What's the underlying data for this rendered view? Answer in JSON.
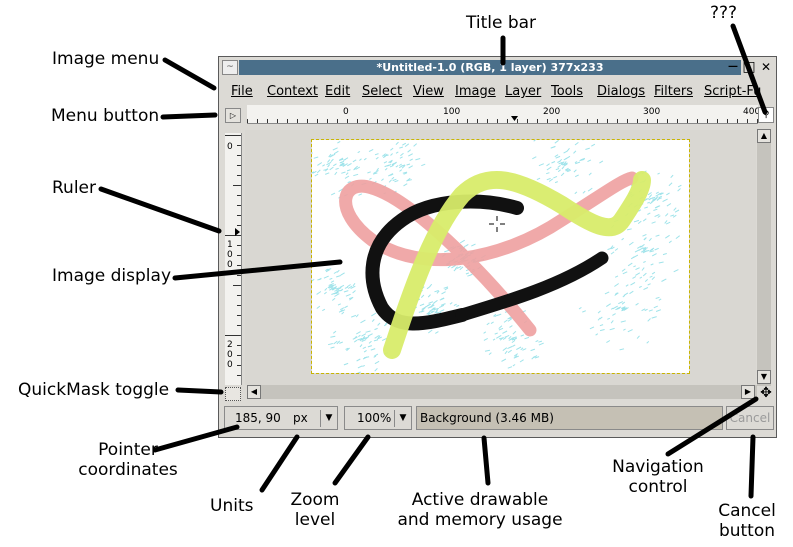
{
  "window": {
    "title": "*Untitled-1.0 (RGB, 1 layer) 377x233",
    "minimize_glyph": "—",
    "maximize_glyph": "□",
    "close_glyph": "✕"
  },
  "menus": [
    "File",
    "Context",
    "Edit",
    "Select",
    "View",
    "Image",
    "Layer",
    "Tools",
    "Dialogs",
    "Filters",
    "Script-Fu"
  ],
  "ruler": {
    "horizontal_ticks": [
      "0",
      "100",
      "200",
      "300",
      "400"
    ],
    "vertical_ticks": [
      "0",
      "1\n0\n0",
      "2\n0\n0"
    ]
  },
  "status": {
    "coordinates": "185, 90",
    "units": "px",
    "zoom": "100%",
    "drawable": "Background (3.46 MB)",
    "cancel": "Cancel"
  },
  "labels": {
    "title_bar": "Title bar",
    "unknown": "???",
    "image_menu": "Image menu",
    "menu_button": "Menu button",
    "ruler": "Ruler",
    "image_display": "Image display",
    "quickmask_toggle": "QuickMask toggle",
    "pointer_coordinates": "Pointer\ncoordinates",
    "units": "Units",
    "zoom_level": "Zoom\nlevel",
    "active_drawable": "Active drawable\nand memory usage",
    "navigation_control": "Navigation\ncontrol",
    "cancel_button": "Cancel\nbutton"
  },
  "colors": {
    "title_bar": "#4a6f8a",
    "window_bg": "#dcdad5",
    "drawable_bg": "#c5c0b4",
    "stroke_yellow": "#d8ec6a",
    "stroke_pink": "#eea0a0",
    "stroke_black": "#111111",
    "speckle_cyan": "#9fe3ea"
  }
}
